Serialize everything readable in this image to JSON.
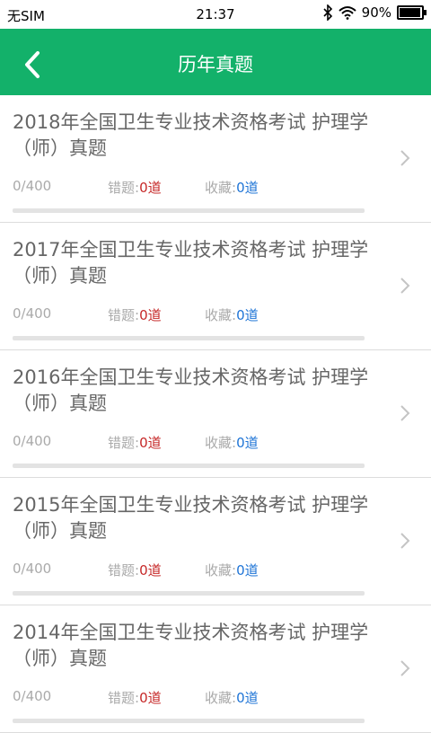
{
  "status_bar": {
    "carrier": "无SIM",
    "time": "21:37",
    "battery": "90%",
    "battery_level": 0.9
  },
  "header": {
    "title": "历年真题"
  },
  "items": [
    {
      "title": "2018年全国卫生专业技术资格考试 护理学（师）真题",
      "progress": "0/400",
      "progress_value": 0,
      "wrong_label": "错题:",
      "wrong_value": "0道",
      "fav_label": "收藏:",
      "fav_value": "0道"
    },
    {
      "title": "2017年全国卫生专业技术资格考试 护理学（师）真题",
      "progress": "0/400",
      "progress_value": 0,
      "wrong_label": "错题:",
      "wrong_value": "0道",
      "fav_label": "收藏:",
      "fav_value": "0道"
    },
    {
      "title": "2016年全国卫生专业技术资格考试 护理学（师）真题",
      "progress": "0/400",
      "progress_value": 0,
      "wrong_label": "错题:",
      "wrong_value": "0道",
      "fav_label": "收藏:",
      "fav_value": "0道"
    },
    {
      "title": "2015年全国卫生专业技术资格考试 护理学（师）真题",
      "progress": "0/400",
      "progress_value": 0,
      "wrong_label": "错题:",
      "wrong_value": "0道",
      "fav_label": "收藏:",
      "fav_value": "0道"
    },
    {
      "title": "2014年全国卫生专业技术资格考试 护理学（师）真题",
      "progress": "0/400",
      "progress_value": 0,
      "wrong_label": "错题:",
      "wrong_value": "0道",
      "fav_label": "收藏:",
      "fav_value": "0道"
    }
  ],
  "colors": {
    "header": "#13b16a",
    "wrong": "#c62828",
    "favorite": "#1e74d6"
  }
}
